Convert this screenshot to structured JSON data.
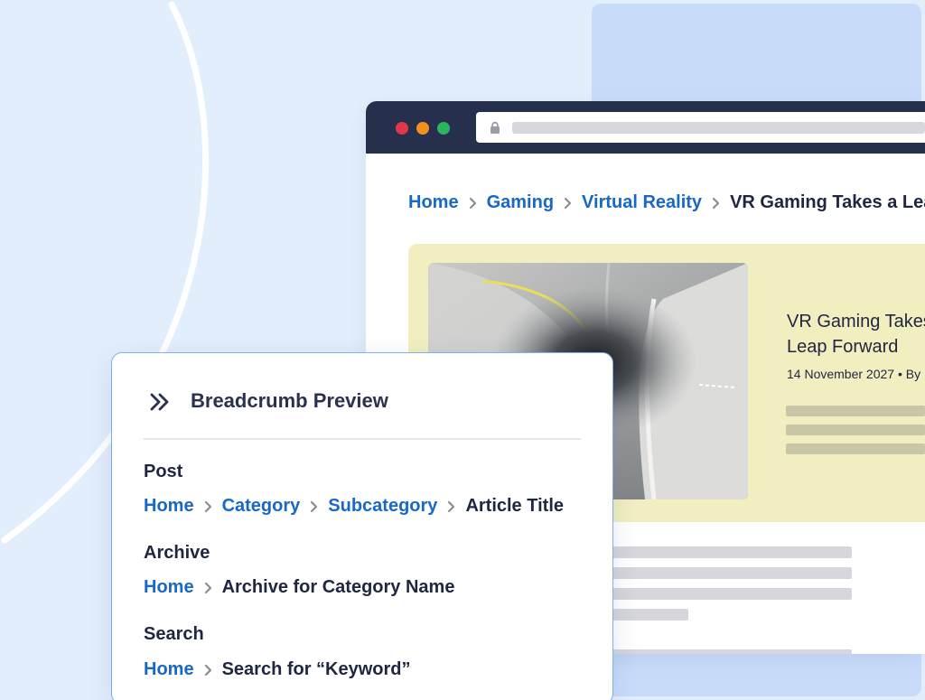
{
  "browser": {
    "breadcrumb": [
      {
        "label": "Home",
        "link": true
      },
      {
        "label": "Gaming",
        "link": true
      },
      {
        "label": "Virtual Reality",
        "link": true
      },
      {
        "label": "VR Gaming Takes a Leap Forward",
        "link": false
      }
    ],
    "article": {
      "title_line1": "VR Gaming Takes a",
      "title_line2": "Leap Forward",
      "date": "14 November 2027",
      "byline": "By"
    }
  },
  "preview": {
    "title": "Breadcrumb Preview",
    "icon": "double-chevron-right-icon",
    "sections": {
      "post": {
        "label": "Post",
        "crumbs": [
          {
            "label": "Home",
            "link": true
          },
          {
            "label": "Category",
            "link": true
          },
          {
            "label": "Subcategory",
            "link": true
          },
          {
            "label": "Article Title",
            "link": false
          }
        ]
      },
      "archive": {
        "label": "Archive",
        "crumbs": [
          {
            "label": "Home",
            "link": true
          },
          {
            "label": "Archive for Category Name",
            "link": false
          }
        ]
      },
      "search": {
        "label": "Search",
        "crumbs": [
          {
            "label": "Home",
            "link": true
          },
          {
            "label": "Search for “Keyword”",
            "link": false
          }
        ]
      }
    }
  },
  "colors": {
    "background": "#e3eefc",
    "link": "#1868c7",
    "text": "#1e2640",
    "browser_bar": "#26304d",
    "hero_background": "#f1efc0",
    "card_border": "#7eb0ec"
  }
}
